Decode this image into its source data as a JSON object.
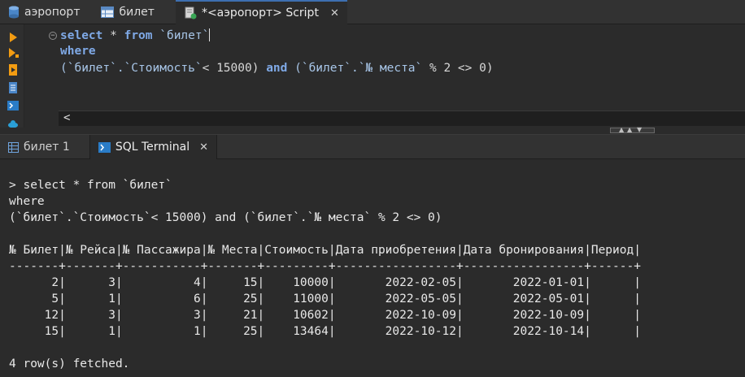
{
  "editor_tabs": [
    {
      "label": "аэропорт",
      "icon": "database-icon"
    },
    {
      "label": "билет",
      "icon": "table-icon"
    },
    {
      "label": "*<аэропорт> Script",
      "icon": "script-icon",
      "active": true
    }
  ],
  "editor": {
    "line1_kw1": "select",
    "line1_rest": " * ",
    "line1_kw2": "from",
    "line1_table": " `билет`",
    "line2_kw": "where",
    "line3_a": "(`билет`.`Стоимость`",
    "line3_b": "< 15000) ",
    "line3_and": "and",
    "line3_c": " (`билет`.`№ места`",
    "line3_d": " % 2 <> 0)"
  },
  "hscroll_arrow": "<",
  "result_tabs": [
    {
      "label": "билет 1",
      "icon": "grid-icon"
    },
    {
      "label": "SQL Terminal",
      "icon": "terminal-icon",
      "active": true
    }
  ],
  "terminal": {
    "lines": [
      "> select * from `билет`",
      "where",
      "(`билет`.`Стоимость`< 15000) and (`билет`.`№ места` % 2 <> 0)",
      "",
      "№ Билет|№ Рейса|№ Пассажира|№ Места|Стоимость|Дата приобретения|Дата бронирования|Период|",
      "-------+-------+-----------+-------+---------+-----------------+-----------------+------+",
      "      2|      3|          4|     15|    10000|       2022-02-05|       2022-01-01|      |",
      "      5|      1|          6|     25|    11000|       2022-05-05|       2022-05-01|      |",
      "     12|      3|          3|     21|    10602|       2022-10-09|       2022-10-09|      |",
      "     15|      1|          1|     25|    13464|       2022-10-12|       2022-10-14|      |",
      "",
      "4 row(s) fetched."
    ]
  },
  "colors": {
    "keyword": "#7fa9e6",
    "identifier": "#a8c6e8",
    "accent": "#3d6fb0"
  }
}
